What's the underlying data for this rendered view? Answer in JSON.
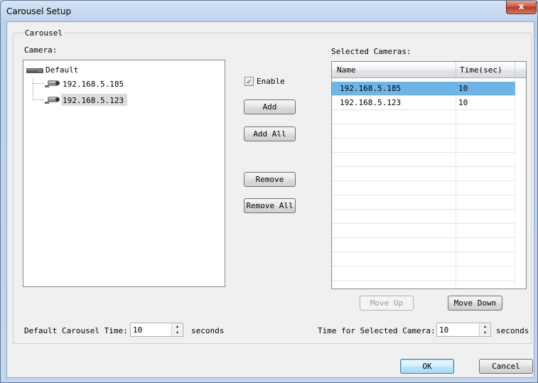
{
  "window": {
    "title": "Carousel Setup",
    "close_glyph": "x"
  },
  "carousel": {
    "group_label": "Carousel",
    "camera_label": "Camera:",
    "tree": {
      "root": "Default",
      "children": [
        "192.168.5.185",
        "192.168.5.123"
      ]
    },
    "enable_label": "Enable",
    "enable_checked": true,
    "buttons": {
      "add": "Add",
      "add_all": "Add All",
      "remove": "Remove",
      "remove_all": "Remove All",
      "move_up": "Move Up",
      "move_down": "Move Down"
    },
    "selected_label": "Selected Cameras:",
    "grid": {
      "headers": [
        "Name",
        "Time(sec)"
      ],
      "rows": [
        [
          "192.168.5.185",
          "10"
        ],
        [
          "192.168.5.123",
          "10"
        ]
      ]
    },
    "default_time_label": "Default Carousel Time:",
    "default_time_value": "10",
    "default_time_unit": "seconds",
    "selected_time_label": "Time for Selected Camera:",
    "selected_time_value": "10",
    "selected_time_unit": "seconds"
  },
  "footer": {
    "ok": "OK",
    "cancel": "Cancel"
  },
  "colors": {
    "selection": "#6fb4e6",
    "close": "#c7503b"
  }
}
